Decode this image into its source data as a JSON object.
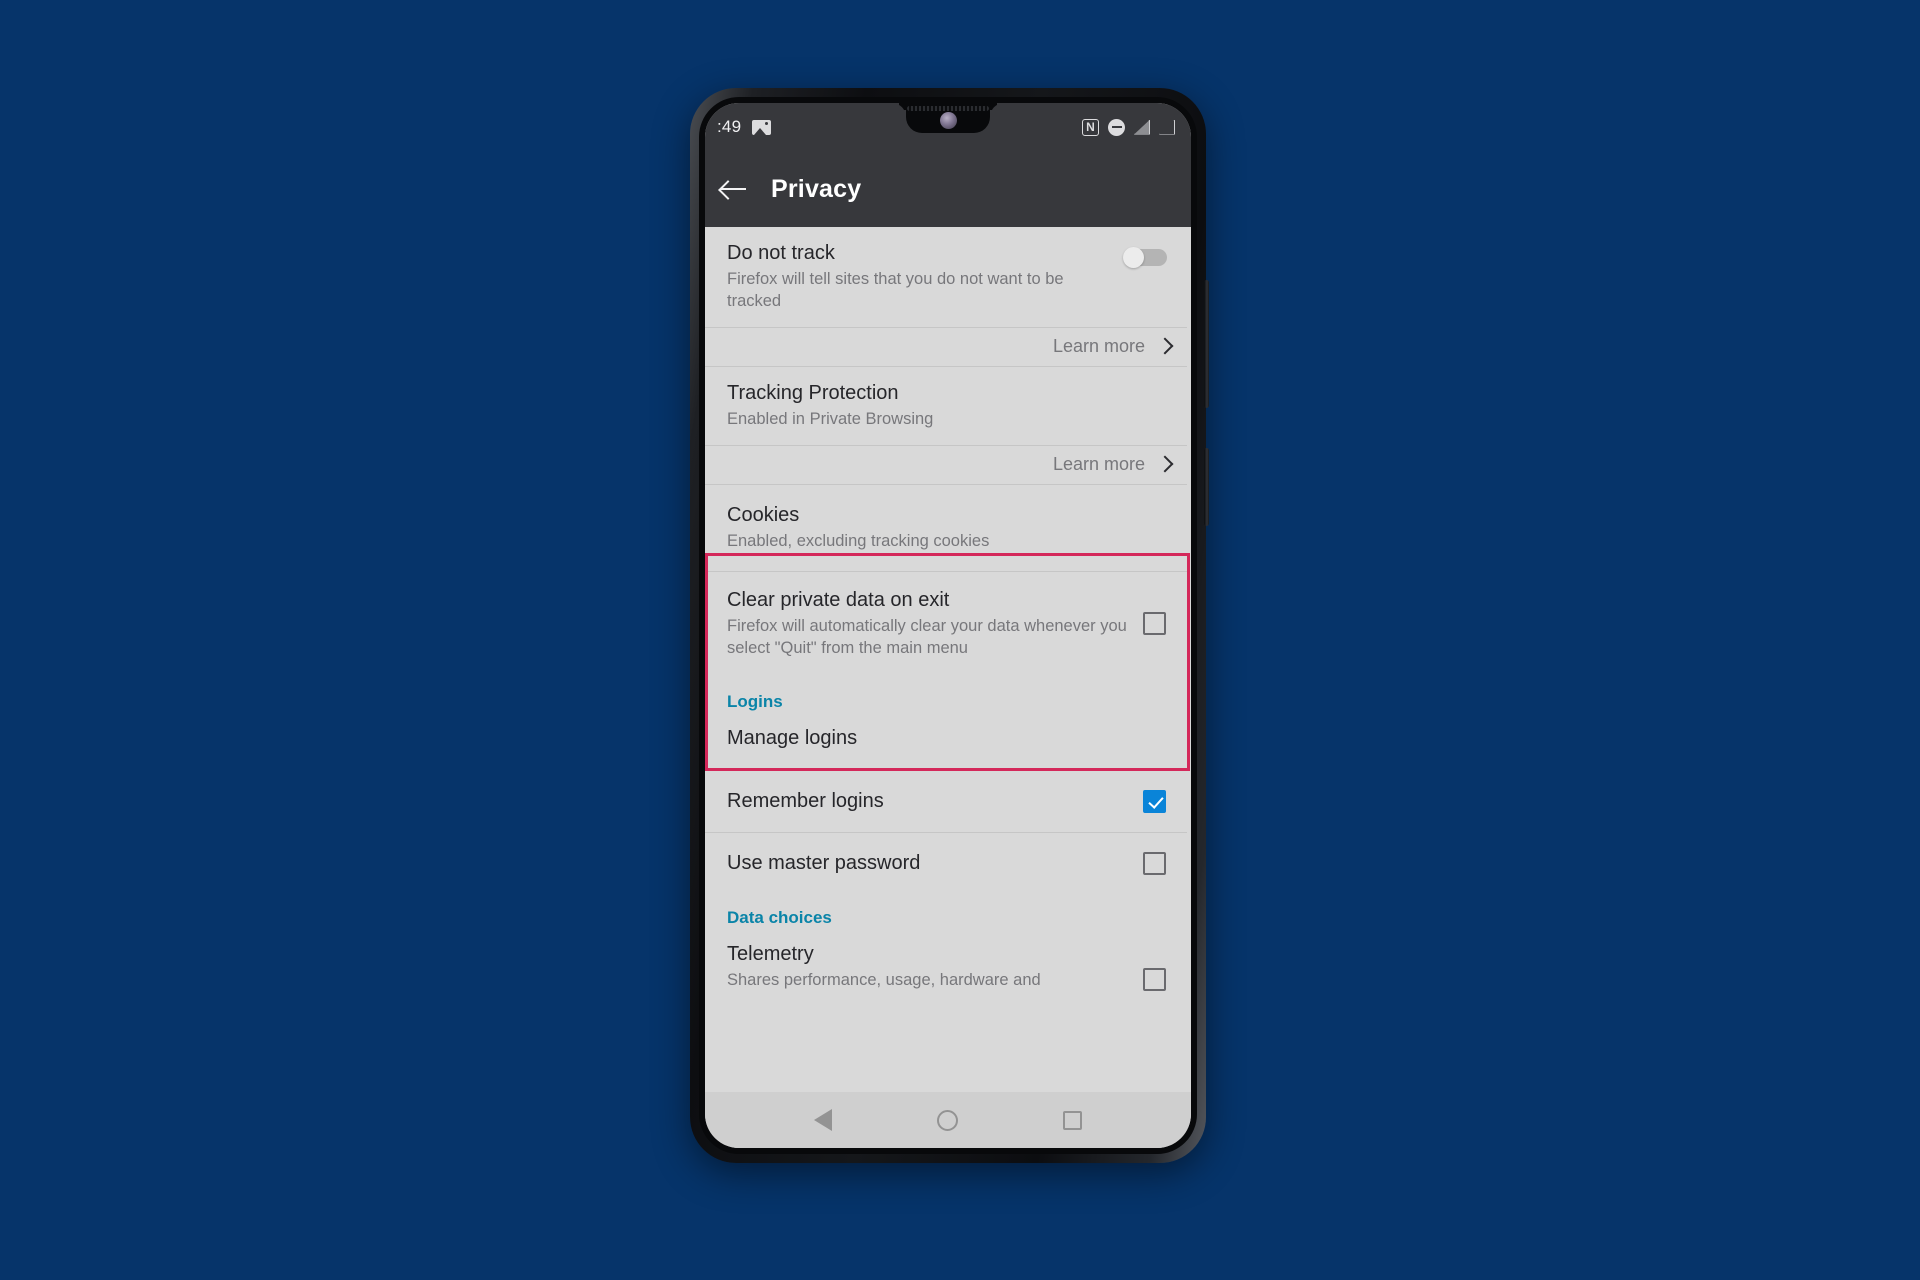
{
  "background_color": "#06346a",
  "device": {
    "name": "android-phone",
    "earpiece": "earpiece-grille",
    "front_camera": "front-camera",
    "side_buttons": [
      "volume-rocker",
      "power-button"
    ]
  },
  "status_bar": {
    "time": ":49",
    "left_icons": [
      "photo-icon"
    ],
    "right_icons": [
      "nfc-icon",
      "do-not-disturb-icon",
      "signal-icon",
      "battery-icon"
    ],
    "nfc_glyph": "N"
  },
  "app_bar": {
    "back_label": "Back",
    "title": "Privacy"
  },
  "settings": {
    "do_not_track": {
      "title": "Do not track",
      "subtitle": "Firefox will tell sites that you do not want to be tracked",
      "toggle_state": "off"
    },
    "learn_more_1": {
      "label": "Learn more"
    },
    "tracking_protection": {
      "title": "Tracking Protection",
      "subtitle": "Enabled in Private Browsing"
    },
    "learn_more_2": {
      "label": "Learn more"
    },
    "cookies": {
      "title": "Cookies",
      "subtitle": "Enabled, excluding tracking cookies"
    },
    "clear_private_data": {
      "title": "Clear private data on exit",
      "subtitle": "Firefox will automatically clear your data whenever you select \"Quit\" from the main menu",
      "checkbox_state": "unchecked"
    },
    "logins_header": "Logins",
    "manage_logins": {
      "title": "Manage logins"
    },
    "remember_logins": {
      "title": "Remember logins",
      "checkbox_state": "checked"
    },
    "use_master_password": {
      "title": "Use master password",
      "checkbox_state": "unchecked"
    },
    "data_choices_header": "Data choices",
    "telemetry": {
      "title": "Telemetry",
      "subtitle": "Shares performance, usage, hardware and",
      "checkbox_state": "unchecked"
    }
  },
  "annotation": {
    "highlight_color": "#d4285a",
    "describes": "cookies-and-clear-private-data-rows"
  },
  "nav_bar": {
    "items": [
      "back-button",
      "home-button",
      "recents-button"
    ]
  },
  "colors": {
    "accent_section_header": "#0a84a8",
    "checkbox_checked": "#0a84d8",
    "app_bar_bg": "#37383c",
    "list_bg": "#d9d9d9"
  }
}
